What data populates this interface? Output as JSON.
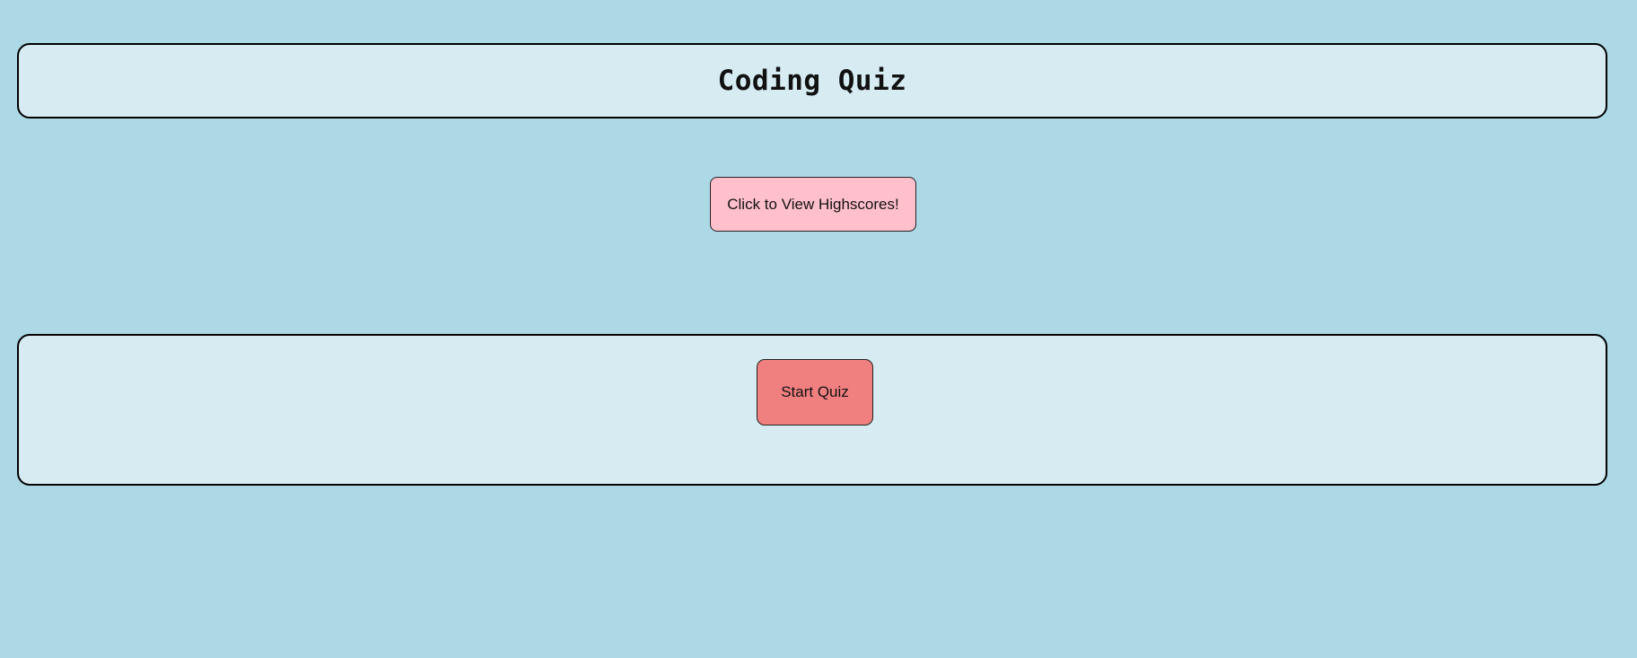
{
  "header": {
    "title": "Coding Quiz"
  },
  "highscores": {
    "button_label": "Click to View Highscores!"
  },
  "quiz": {
    "start_label": "Start Quiz"
  },
  "colors": {
    "page_background": "#add8e6",
    "panel_background": "#d6ecf2",
    "highscores_button": "#ffc0cb",
    "start_button": "#f08080"
  }
}
